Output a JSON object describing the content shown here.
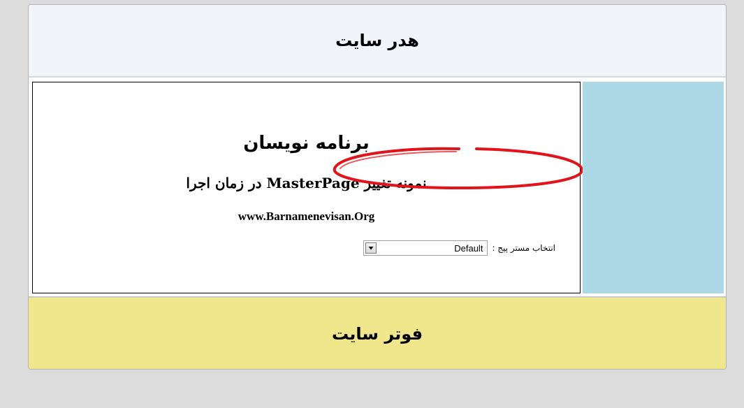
{
  "header": {
    "title": "هدر سایت"
  },
  "content": {
    "title": "برنامه نویسان",
    "subtitle": "نمونه تغییر MasterPage در زمان اجرا",
    "url": "www.Barnamenevisan.Org",
    "selector": {
      "label": "انتخاب مستر پیج :",
      "selected": "Default"
    }
  },
  "footer": {
    "title": "فوتر سایت"
  },
  "colors": {
    "header_bg": "#f1f5fa",
    "sidebar_bg": "#add8e6",
    "footer_bg": "#f0e68c",
    "annotation": "#e0141a"
  },
  "icons": {
    "dropdown": "chevron-down-icon",
    "annotation": "red-ellipse-highlight"
  }
}
